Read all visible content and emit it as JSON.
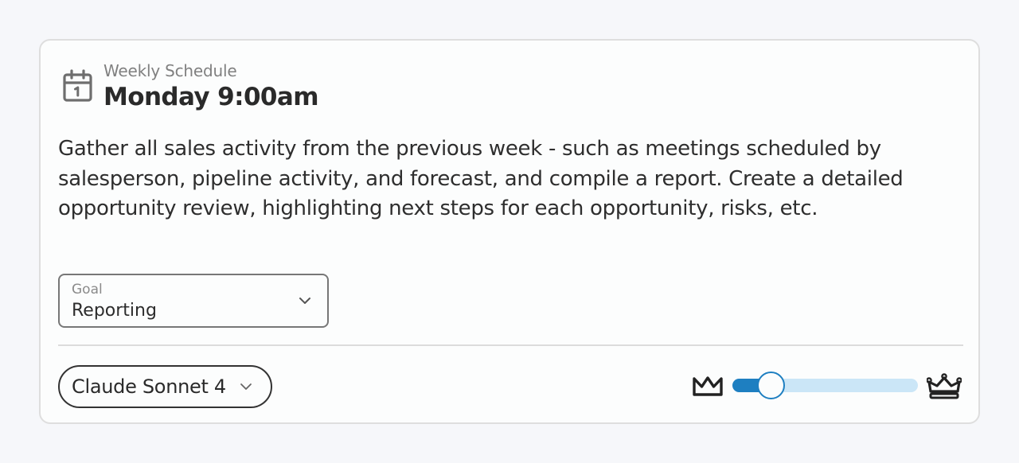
{
  "schedule": {
    "eyebrow": "Weekly Schedule",
    "title": "Monday 9:00am",
    "icon": "calendar-icon"
  },
  "task": {
    "description": "Gather all sales activity from the previous week - such as meetings scheduled by salesperson, pipeline activity, and forecast, and compile a report. Create a detailed opportunity review, highlighting next steps for each opportunity, risks, etc."
  },
  "goal": {
    "label": "Goal",
    "value": "Reporting"
  },
  "model": {
    "label": "Claude Sonnet 4"
  },
  "effort_slider": {
    "level": 0.21,
    "min_icon": "crown-icon",
    "max_icon": "crown-jewel-icon",
    "colors": {
      "fill": "#1e7fc1",
      "track": "#cbe6f7"
    }
  }
}
